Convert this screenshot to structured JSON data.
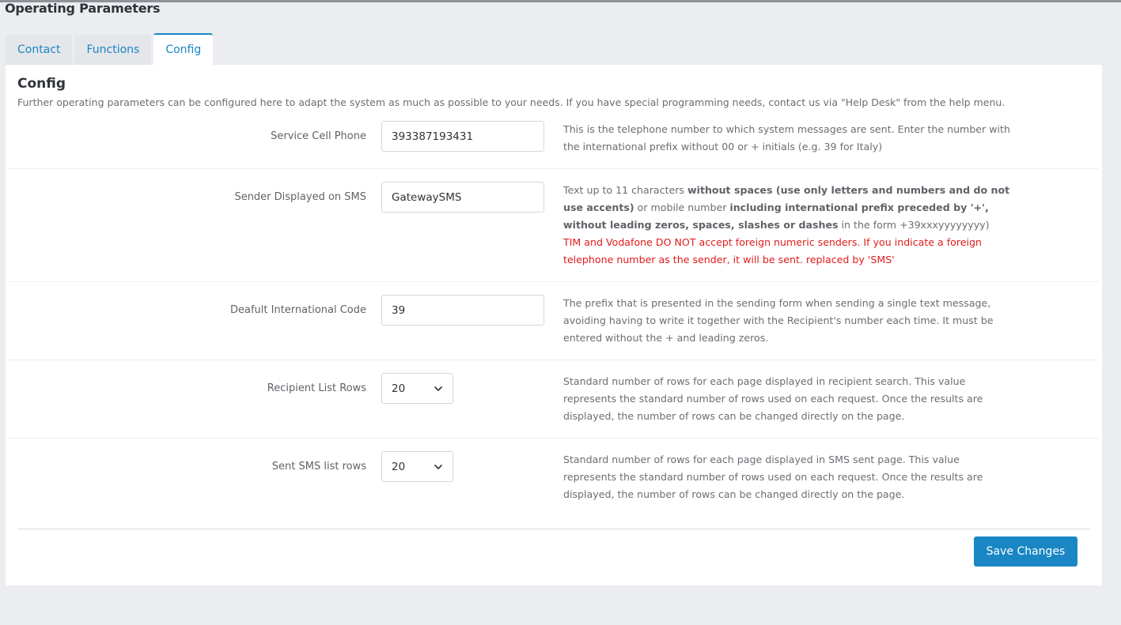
{
  "page": {
    "title": "Operating Parameters"
  },
  "tabs": [
    {
      "label": "Contact"
    },
    {
      "label": "Functions"
    },
    {
      "label": "Config"
    }
  ],
  "config": {
    "title": "Config",
    "description": "Further operating parameters can be configured here to adapt the system as much as possible to your needs. If you have special programming needs, contact us via \"Help Desk\" from the help menu.",
    "rows": [
      {
        "label": "Service Cell Phone",
        "value": "393387193431",
        "help": "This is the telephone number to which system messages are sent. Enter the number with the international prefix without 00 or + initials (e.g. 39 for Italy)"
      },
      {
        "label": "Sender Displayed on SMS",
        "value": "GatewaySMS",
        "help_parts": {
          "p1": "Text up to 11 characters ",
          "b1": "without spaces (use only letters and numbers and do not use accents)",
          "p2": " or mobile number ",
          "b2": "including international prefix preceded by '+', without leading zeros, spaces, slashes or dashes",
          "p3": " in the form +39xxxyyyyyyyy)",
          "warning": "TIM and Vodafone DO NOT accept foreign numeric senders. If you indicate a foreign telephone number as the sender, it will be sent. replaced by 'SMS'"
        }
      },
      {
        "label": "Deafult International Code",
        "value": "39",
        "help": "The prefix that is presented in the sending form when sending a single text message, avoiding having to write it together with the Recipient's number each time. It must be entered without the + and leading zeros."
      },
      {
        "label": "Recipient List Rows",
        "value": "20",
        "help": "Standard number of rows for each page displayed in recipient search. This value represents the standard number of rows used on each request. Once the results are displayed, the number of rows can be changed directly on the page."
      },
      {
        "label": "Sent SMS list rows",
        "value": "20",
        "help": "Standard number of rows for each page displayed in SMS sent page. This value represents the standard number of rows used on each request. Once the results are displayed, the number of rows can be changed directly on the page."
      }
    ],
    "save_label": "Save Changes"
  },
  "colors": {
    "accent": "#1a86c4",
    "warning": "#e11b1b",
    "background": "#ecedf1"
  },
  "icons": {
    "select_arrow": "chevron-down-icon"
  }
}
